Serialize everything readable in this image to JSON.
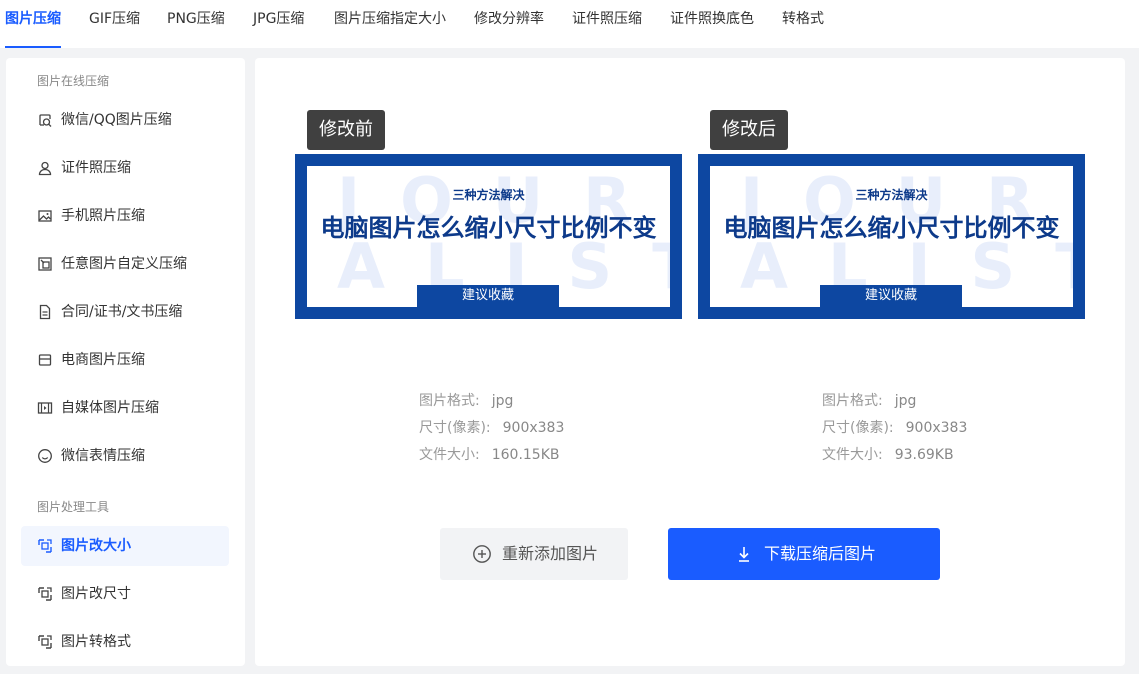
{
  "tabs": [
    {
      "label": "图片压缩",
      "active": true
    },
    {
      "label": "GIF压缩"
    },
    {
      "label": "PNG压缩"
    },
    {
      "label": "JPG压缩"
    },
    {
      "label": "图片压缩指定大小"
    },
    {
      "label": "修改分辨率"
    },
    {
      "label": "证件照压缩"
    },
    {
      "label": "证件照换底色"
    },
    {
      "label": "转格式"
    }
  ],
  "sidebar": {
    "section1_title": "图片在线压缩",
    "section1_items": [
      {
        "label": "微信/QQ图片压缩",
        "icon": "image-search-icon"
      },
      {
        "label": "证件照压缩",
        "icon": "person-icon"
      },
      {
        "label": "手机照片压缩",
        "icon": "photo-icon"
      },
      {
        "label": "任意图片自定义压缩",
        "icon": "custom-image-icon"
      },
      {
        "label": "合同/证书/文书压缩",
        "icon": "document-icon"
      },
      {
        "label": "电商图片压缩",
        "icon": "box-icon"
      },
      {
        "label": "自媒体图片压缩",
        "icon": "film-icon"
      },
      {
        "label": "微信表情压缩",
        "icon": "smile-icon"
      }
    ],
    "section2_title": "图片处理工具",
    "section2_items": [
      {
        "label": "图片改大小",
        "icon": "resize-icon",
        "active": true
      },
      {
        "label": "图片改尺寸",
        "icon": "resize-icon"
      },
      {
        "label": "图片转格式",
        "icon": "resize-icon"
      }
    ]
  },
  "preview": {
    "before_tag": "修改前",
    "after_tag": "修改后",
    "banner_subtitle": "三种方法解决",
    "banner_title": "电脑图片怎么缩小尺寸比例不变",
    "banner_ribbon": "建议收藏",
    "banner_watermark_top": "JOURN",
    "banner_watermark_bottom": "ALIST"
  },
  "before_info": {
    "format_label": "图片格式:",
    "format_value": "jpg",
    "size_label": "尺寸(像素):",
    "size_value": "900x383",
    "filesize_label": "文件大小:",
    "filesize_value": "160.15KB"
  },
  "after_info": {
    "format_label": "图片格式:",
    "format_value": "jpg",
    "size_label": "尺寸(像素):",
    "size_value": "900x383",
    "filesize_label": "文件大小:",
    "filesize_value": "93.69KB"
  },
  "actions": {
    "readd_label": "重新添加图片",
    "download_label": "下载压缩后图片"
  },
  "colors": {
    "accent": "#1a5cff",
    "banner_blue": "#0d47a1",
    "tag_bg": "#404040"
  }
}
